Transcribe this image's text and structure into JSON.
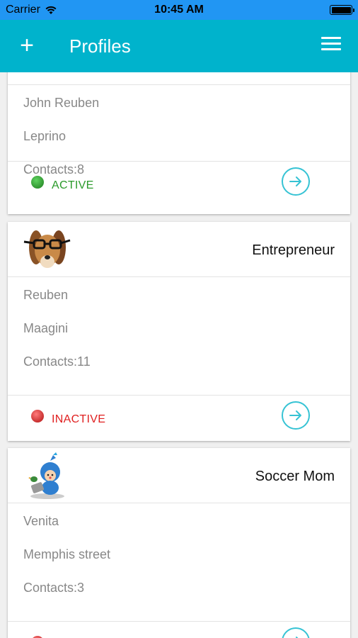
{
  "status_bar": {
    "carrier": "Carrier",
    "time": "10:45 AM"
  },
  "navbar": {
    "add_label": "+",
    "title": "Profiles"
  },
  "colors": {
    "accent": "#00b3cc",
    "status_bar": "#2196f3",
    "active": "#2a9a2a",
    "inactive": "#e02020",
    "arrow": "#36c3d4"
  },
  "profiles": [
    {
      "title": "",
      "fields": [
        "John Reuben",
        "Leprino",
        "Contacts:8"
      ],
      "status": "ACTIVE",
      "status_color": "#2a9a2a",
      "avatar_icon": "none"
    },
    {
      "title": "Entrepreneur",
      "fields": [
        "Reuben",
        "Maagini",
        "Contacts:11"
      ],
      "status": "INACTIVE",
      "status_color": "#e02020",
      "avatar_icon": "dog-with-glasses"
    },
    {
      "title": "Soccer Mom",
      "fields": [
        "Venita",
        "Memphis street",
        "Contacts:3"
      ],
      "status": "",
      "status_color": "#e02020",
      "avatar_icon": "cartoon-kid-with-laptop"
    }
  ]
}
